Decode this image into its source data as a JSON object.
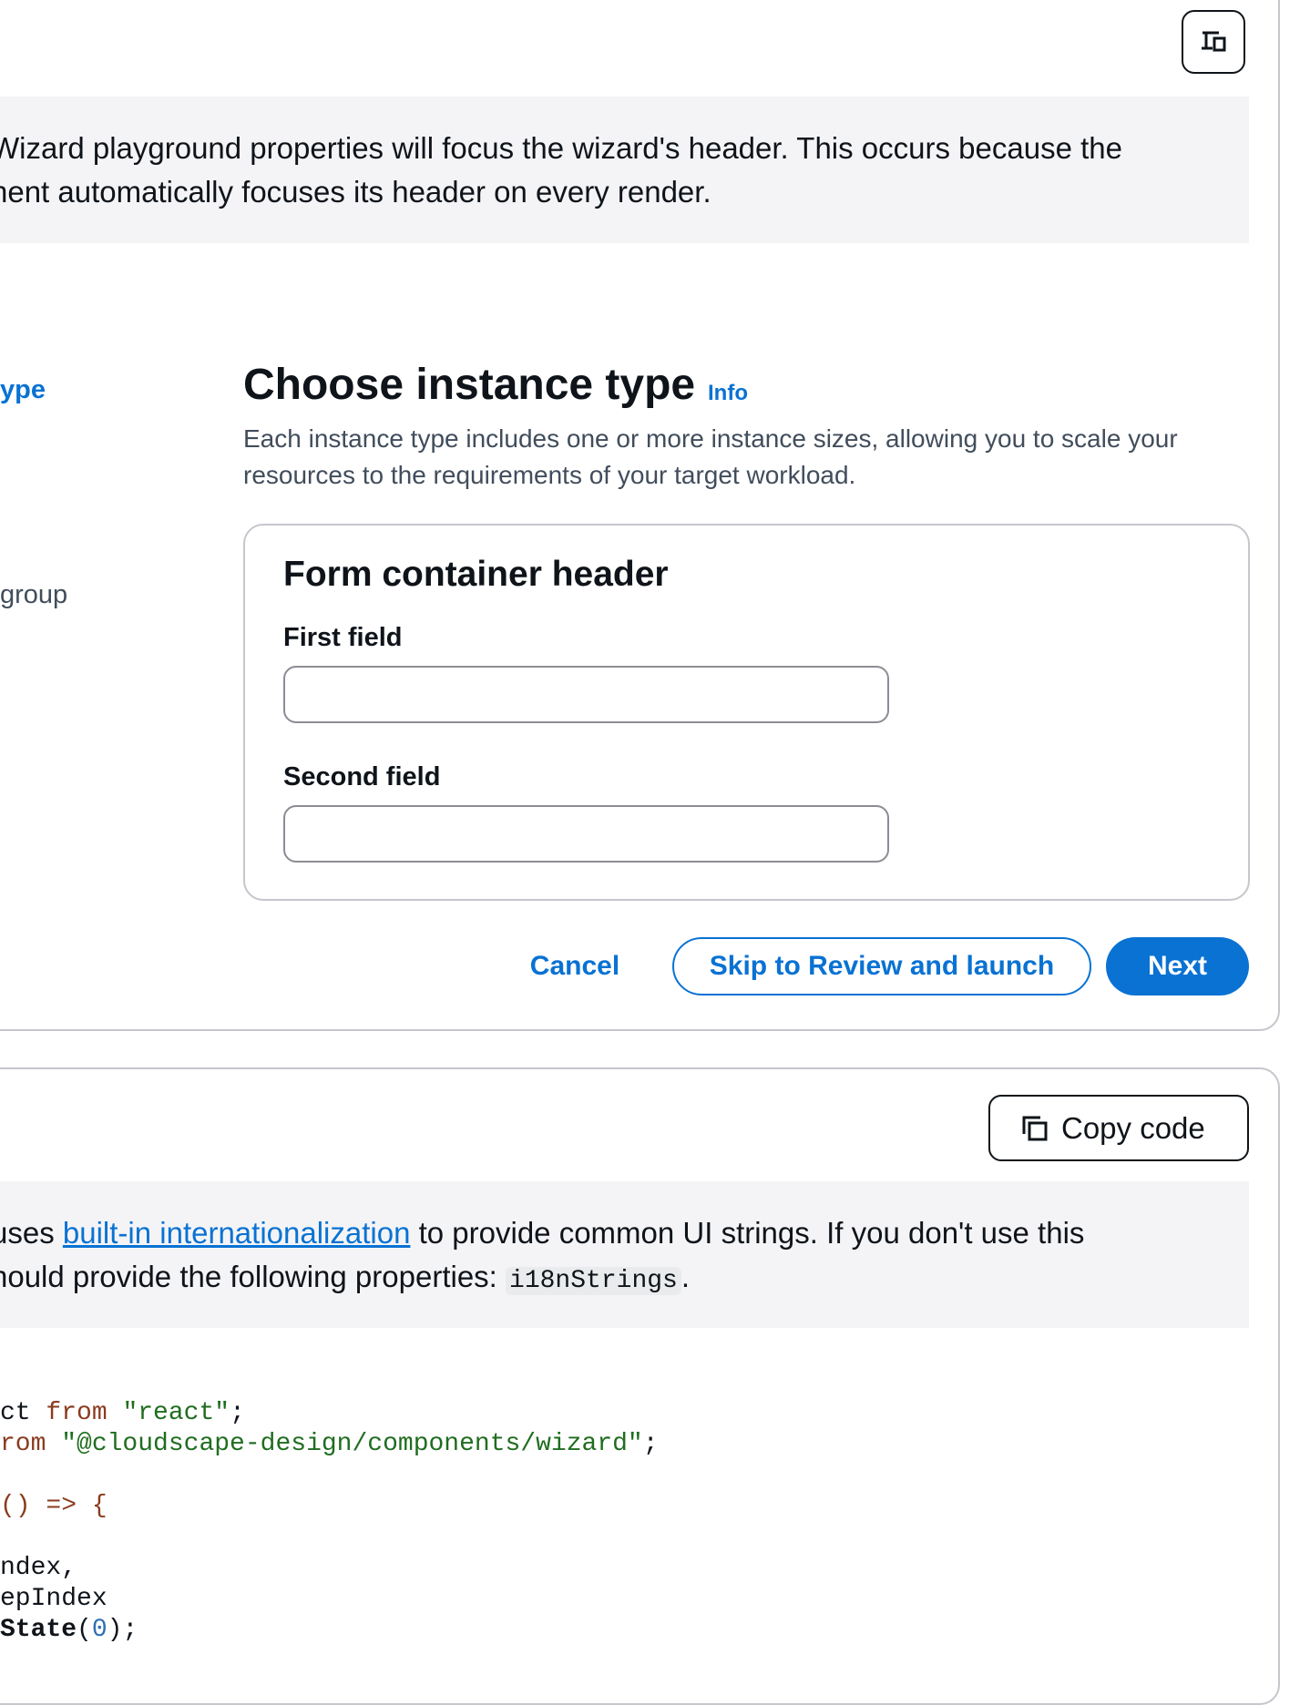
{
  "top_panel": {
    "view_toggle_icon": "device-toggle-icon",
    "alert": {
      "line1": "Wizard playground properties will focus the wizard's header. This occurs because the",
      "line2": "nent automatically focuses its header on every render."
    },
    "navigation": {
      "item_active": "ype",
      "item_other": "group"
    },
    "step": {
      "title": "Choose instance type",
      "info_link": "Info",
      "description": "Each instance type includes one or more instance sizes, allowing you to scale your resources to the requirements of your target workload."
    },
    "form_container": {
      "header": "Form container header",
      "first_field_label": "First field",
      "first_field_value": "",
      "second_field_label": "Second field",
      "second_field_value": ""
    },
    "actions": {
      "cancel": "Cancel",
      "skip": "Skip to Review and launch",
      "next": "Next"
    }
  },
  "bottom_panel": {
    "copy_button": {
      "label": "Copy code",
      "icon": "copy-icon"
    },
    "alert": {
      "line1_prefix": "uses ",
      "line1_link": "built-in internationalization",
      "line1_suffix": " to provide common UI strings. If you don't use this",
      "line2_prefix": "hould provide the following properties: ",
      "line2_code": "i18nStrings",
      "line2_suffix": "."
    },
    "code": {
      "l1a": "ct ",
      "l1b": "from",
      "l1c": " \"react\"",
      "l1d": ";",
      "l2a": "rom",
      "l2b": " \"@cloudscape-design/components/wizard\"",
      "l2c": ";",
      "l3": "",
      "l4": "() => {",
      "l5": "",
      "l6": "ndex,",
      "l7": "epIndex",
      "l8a": "State",
      "l8b": "(",
      "l8c": "0",
      "l8d": ");"
    }
  }
}
